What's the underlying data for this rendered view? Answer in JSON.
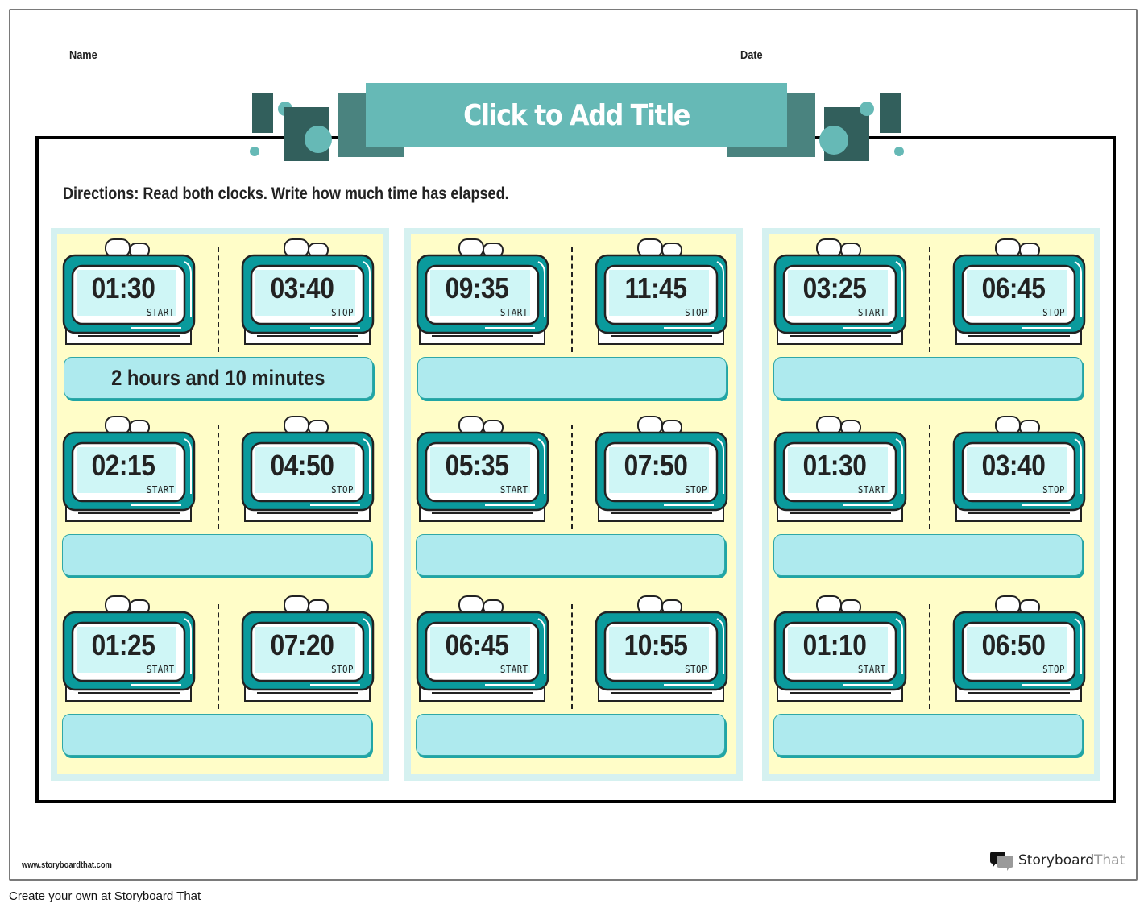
{
  "header": {
    "name_label": "Name",
    "date_label": "Date",
    "title": "Click to Add Title"
  },
  "directions": "Directions: Read both clocks. Write how much time has elapsed.",
  "colors": {
    "banner": "#66b9b6",
    "deco_dark": "#325f5c",
    "deco_mid": "#4a837f",
    "panel_bg": "#fffdc8",
    "panel_border": "#d5f1f0",
    "clock_body": "#0a9a9c",
    "clock_screen": "#cff6f6",
    "answer_box": "#aeeaee"
  },
  "start_label": "START",
  "stop_label": "STOP",
  "panels": [
    {
      "problems": [
        {
          "start": "01:30",
          "stop": "03:40",
          "answer": "2 hours and 10 minutes"
        },
        {
          "start": "02:15",
          "stop": "04:50",
          "answer": ""
        },
        {
          "start": "01:25",
          "stop": "07:20",
          "answer": ""
        }
      ]
    },
    {
      "problems": [
        {
          "start": "09:35",
          "stop": "11:45",
          "answer": ""
        },
        {
          "start": "05:35",
          "stop": "07:50",
          "answer": ""
        },
        {
          "start": "06:45",
          "stop": "10:55",
          "answer": ""
        }
      ]
    },
    {
      "problems": [
        {
          "start": "03:25",
          "stop": "06:45",
          "answer": ""
        },
        {
          "start": "01:30",
          "stop": "03:40",
          "answer": ""
        },
        {
          "start": "01:10",
          "stop": "06:50",
          "answer": ""
        }
      ]
    }
  ],
  "footer": {
    "url": "www.storyboardthat.com",
    "brand_primary": "Storyboard",
    "brand_secondary": "That",
    "create_link": "Create your own at Storyboard That"
  }
}
